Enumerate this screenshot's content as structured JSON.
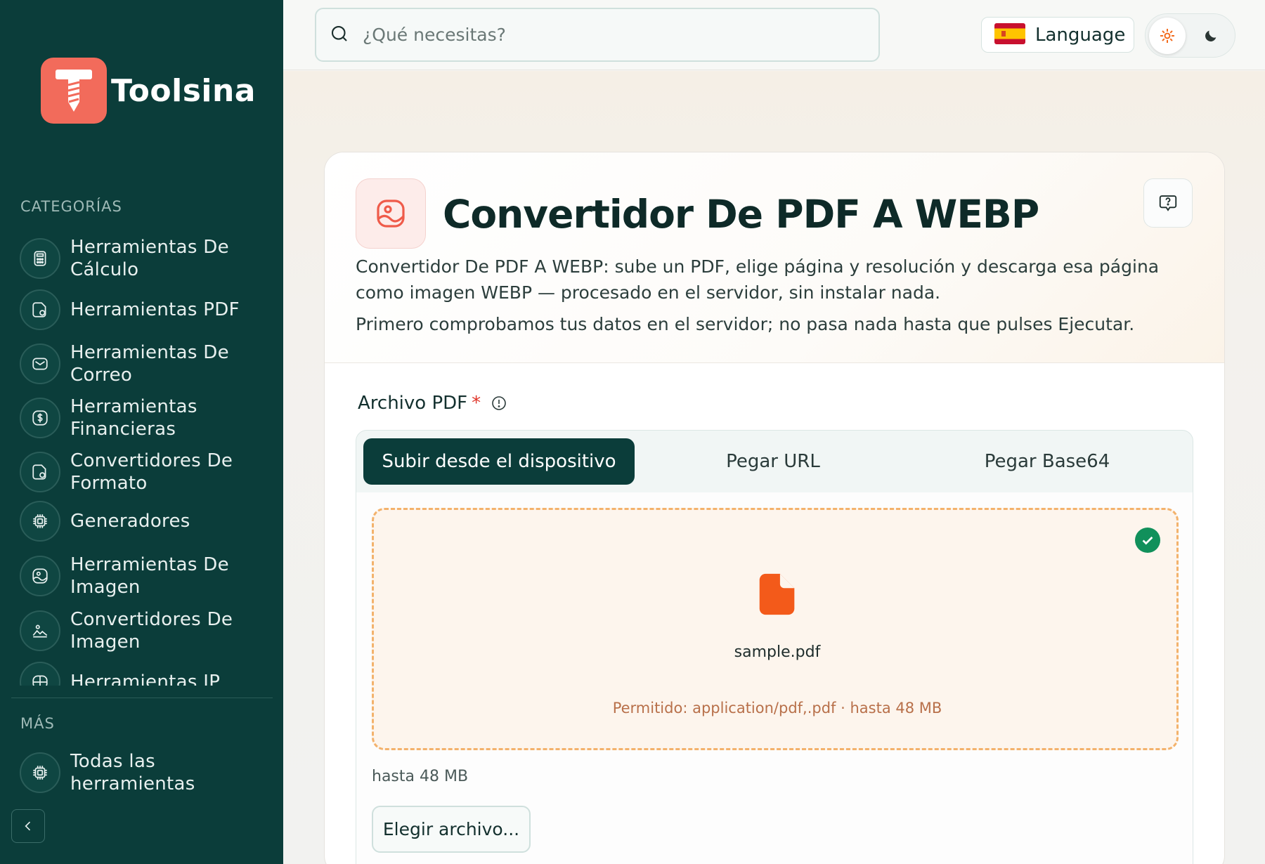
{
  "brand": {
    "name": "Toolsina"
  },
  "sidebar": {
    "categories_title": "CATEGORÍAS",
    "items": [
      {
        "label": "Herramientas De Cálculo",
        "icon": "calculator-icon"
      },
      {
        "label": "Herramientas PDF",
        "icon": "pdf-icon"
      },
      {
        "label": "Herramientas De Correo",
        "icon": "mail-icon"
      },
      {
        "label": "Herramientas Financieras",
        "icon": "dollar-icon"
      },
      {
        "label": "Convertidores De Formato",
        "icon": "convert-icon"
      },
      {
        "label": "Generadores",
        "icon": "chip-icon"
      },
      {
        "label": "Herramientas De Imagen",
        "icon": "image-icon"
      },
      {
        "label": "Convertidores De Imagen",
        "icon": "image-convert-icon"
      },
      {
        "label": "Herramientas IP",
        "icon": "network-icon"
      }
    ],
    "more_title": "MÁS",
    "more_items": [
      {
        "label": "Todas las herramientas",
        "icon": "chip-icon"
      }
    ]
  },
  "topbar": {
    "search_placeholder": "¿Qué necesitas?",
    "language_label": "Language"
  },
  "tool": {
    "title": "Convertidor De PDF A WEBP",
    "description": "Convertidor De PDF A WEBP: sube un PDF, elige página y resolución y descarga esa página como imagen WEBP — procesado en el servidor, sin instalar nada.",
    "note": "Primero comprobamos tus datos en el servidor; no pasa nada hasta que pulses Ejecutar.",
    "field_label": "Archivo PDF",
    "required_mark": "*",
    "tabs": [
      {
        "label": "Subir desde el dispositivo",
        "active": true
      },
      {
        "label": "Pegar URL",
        "active": false
      },
      {
        "label": "Pegar Base64",
        "active": false
      }
    ],
    "file_name": "sample.pdf",
    "allowed": "Permitido: application/pdf,.pdf · hasta 48 MB",
    "size_note": "hasta 48 MB",
    "choose_button": "Elegir archivo..."
  },
  "colors": {
    "sidebar_bg": "#0b3d3a",
    "brand_accent": "#f26b5b",
    "file_accent": "#f35a1a",
    "success": "#11905b"
  }
}
